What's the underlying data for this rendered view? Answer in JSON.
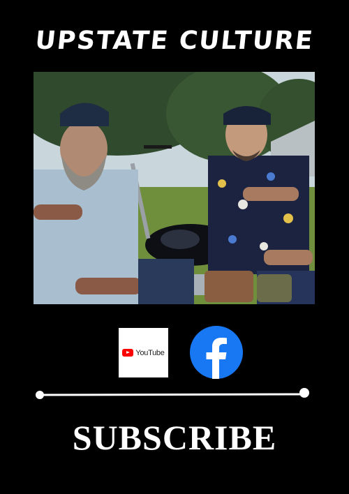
{
  "poster": {
    "title": "UPSTATE CULTURE",
    "cta_label": "SUBSCRIBE"
  },
  "social": {
    "youtube_label": "YouTube",
    "youtube_icon": "youtube-logo-icon",
    "facebook_icon": "facebook-logo-icon"
  },
  "photo": {
    "subject": "two bearded men in caps beside a black motorcycle"
  },
  "colors": {
    "background": "#000000",
    "text": "#ffffff",
    "youtube_red": "#ff0000",
    "facebook_blue": "#1877f2"
  }
}
